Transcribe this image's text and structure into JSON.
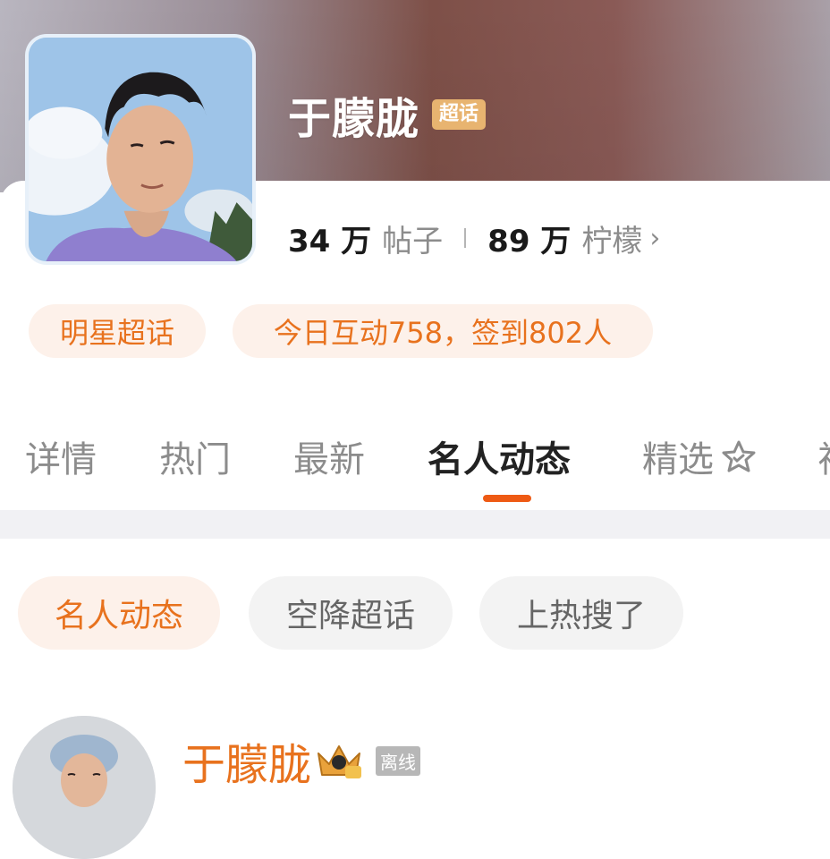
{
  "header": {
    "name": "于朦胧",
    "badge": "超话"
  },
  "stats": {
    "posts_value": "34 万",
    "posts_label": "帖子",
    "lemons_value": "89 万",
    "lemons_label": "柠檬",
    "chevron": "›"
  },
  "tags": {
    "category": "明星超话",
    "activity": "今日互动758，签到802人"
  },
  "tabs": [
    {
      "label": "详情"
    },
    {
      "label": "热门"
    },
    {
      "label": "最新"
    },
    {
      "label": "名人动态"
    },
    {
      "label": "精选"
    },
    {
      "label": "视"
    }
  ],
  "active_tab_index": 3,
  "filters": [
    {
      "label": "名人动态"
    },
    {
      "label": "空降超话"
    },
    {
      "label": "上热搜了"
    }
  ],
  "post": {
    "author": "于朦胧",
    "status": "离线"
  },
  "colors": {
    "accent": "#e8721e",
    "indicator": "#ee5a14",
    "badge": "#e8b470"
  },
  "icons": {
    "tab_special": "sparkle-star-icon",
    "post_badge": "crown-icon"
  }
}
